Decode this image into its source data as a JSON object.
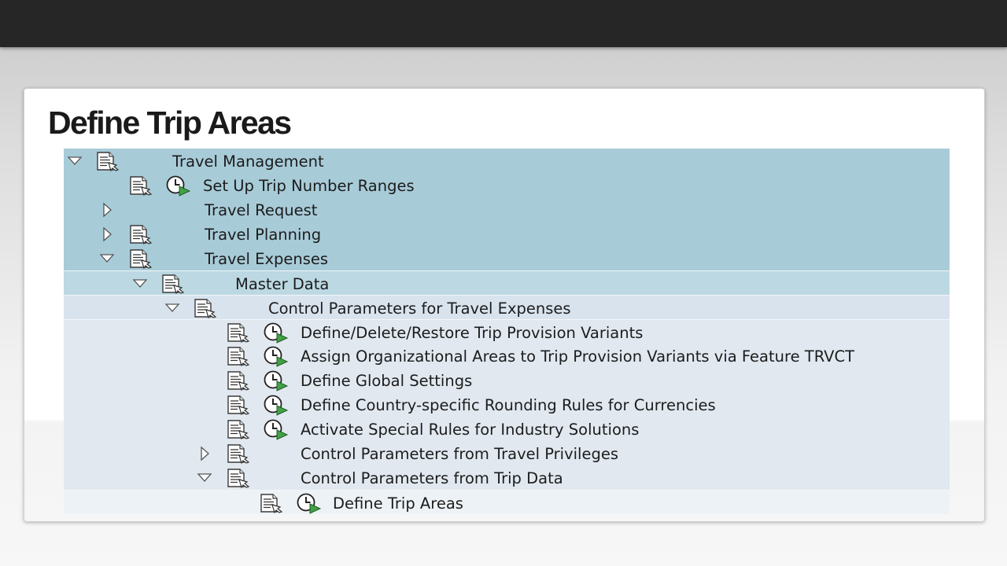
{
  "page": {
    "title": "Define Trip Areas"
  },
  "tree": {
    "rows": [
      {
        "label": "Travel Management"
      },
      {
        "label": "Set Up Trip Number Ranges"
      },
      {
        "label": "Travel Request"
      },
      {
        "label": "Travel Planning"
      },
      {
        "label": "Travel Expenses"
      },
      {
        "label": "Master Data"
      },
      {
        "label": "Control Parameters for Travel Expenses"
      },
      {
        "label": "Define/Delete/Restore Trip Provision Variants"
      },
      {
        "label": "Assign Organizational Areas to Trip Provision Variants via Feature TRVCT"
      },
      {
        "label": "Define Global Settings"
      },
      {
        "label": "Define Country-specific Rounding Rules for Currencies"
      },
      {
        "label": "Activate Special Rules for Industry Solutions"
      },
      {
        "label": "Control Parameters from Travel Privileges"
      },
      {
        "label": "Control Parameters from Trip Data"
      },
      {
        "label": "Define Trip Areas"
      }
    ]
  },
  "colors": {
    "topbar": "#262626",
    "row_level0": "#a8cbd8",
    "row_level1": "#bcd9e3",
    "row_level2": "#d8e3ee",
    "row_level3": "#e1e8f0",
    "execute_icon": "#43a047"
  },
  "icons": {
    "expanded": "triangle-down-icon",
    "collapsed": "triangle-right-icon",
    "document": "document-icon",
    "execute": "execute-clock-icon"
  }
}
